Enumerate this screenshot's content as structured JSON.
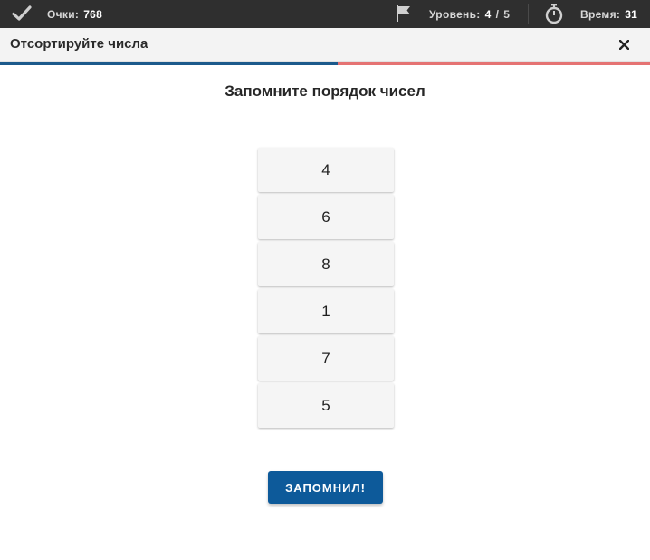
{
  "status_bar": {
    "score_label": "Очки:",
    "score_value": "768",
    "level_label": "Уровень:",
    "level_current": "4",
    "level_separator": "/",
    "level_total": "5",
    "time_label": "Время:",
    "time_value": "31",
    "icons": {
      "score": "check-icon",
      "level": "flag-icon",
      "time": "stopwatch-icon"
    }
  },
  "task": {
    "title": "Отсортируйте числа",
    "close_icon": "close-icon",
    "progress_fraction": 0.52
  },
  "main": {
    "instruction": "Запомните порядок чисел",
    "numbers": [
      "4",
      "6",
      "8",
      "1",
      "7",
      "5"
    ],
    "confirm_button": "ЗАПОМНИЛ!"
  },
  "colors": {
    "top_bar": "#2f2f2f",
    "progress_done": "#1c5a8c",
    "progress_remaining": "#e57373",
    "button": "#0d5a9a"
  }
}
